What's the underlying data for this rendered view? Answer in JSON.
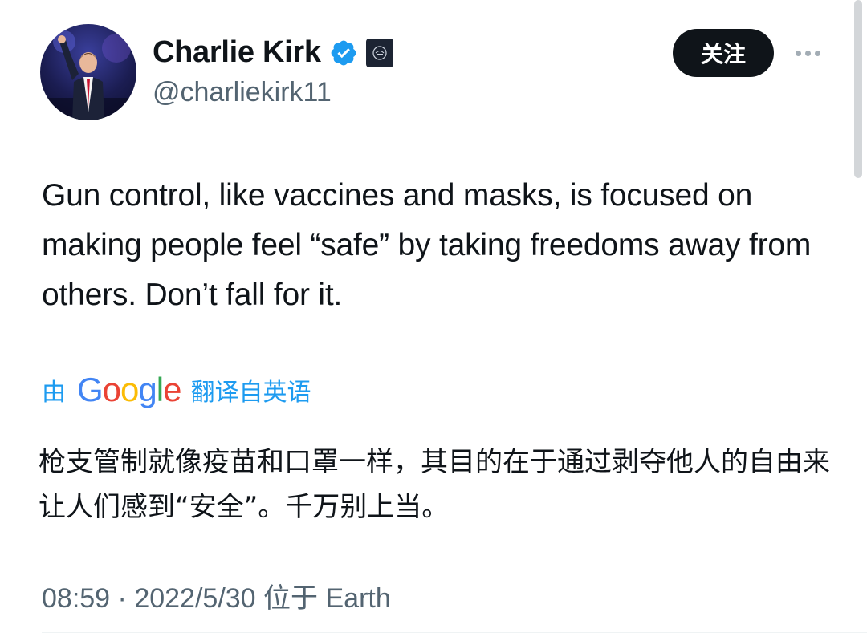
{
  "author": {
    "display_name": "Charlie Kirk",
    "handle": "@charliekirk11",
    "verified": true
  },
  "actions": {
    "follow_label": "关注"
  },
  "tweet": {
    "text": "Gun control, like vaccines and masks, is focused on making people feel “safe” by taking freedoms away from others. Don’t fall for it."
  },
  "translation": {
    "prefix": "由",
    "provider": "Google",
    "suffix": "翻译自英语",
    "text": "枪支管制就像疫苗和口罩一样，其目的在于通过剥夺他人的自由来让人们感到“安全”。千万别上当。"
  },
  "meta": {
    "time": "08:59",
    "separator": "·",
    "date": "2022/5/30",
    "location_prefix": "位于",
    "location": "Earth"
  },
  "colors": {
    "accent": "#1d9bf0",
    "follow_bg": "#0f1419",
    "secondary_text": "#536471"
  }
}
